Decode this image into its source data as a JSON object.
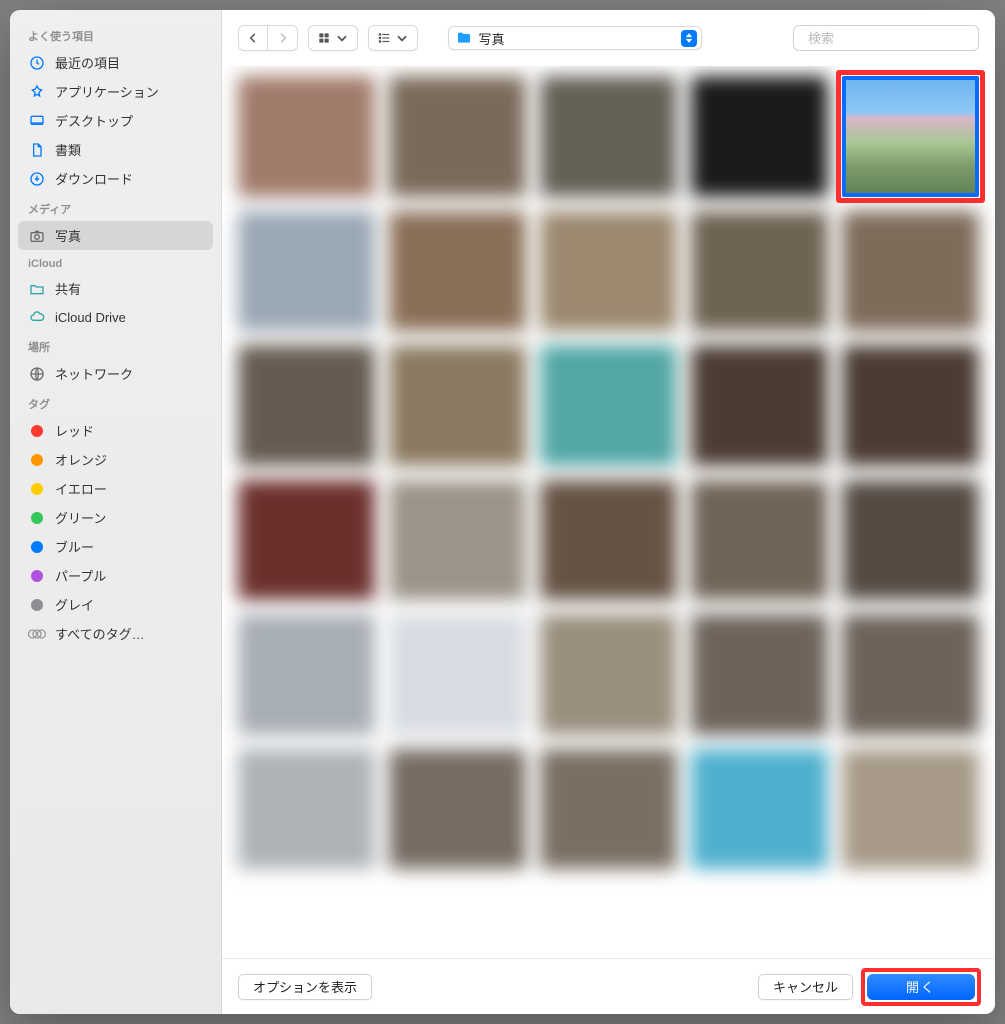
{
  "sidebar": {
    "favorites_label": "よく使う項目",
    "media_label": "メディア",
    "icloud_label": "iCloud",
    "locations_label": "場所",
    "tags_label": "タグ",
    "favorites": [
      {
        "label": "最近の項目"
      },
      {
        "label": "アプリケーション"
      },
      {
        "label": "デスクトップ"
      },
      {
        "label": "書類"
      },
      {
        "label": "ダウンロード"
      }
    ],
    "media": [
      {
        "label": "写真"
      }
    ],
    "icloud": [
      {
        "label": "共有"
      },
      {
        "label": "iCloud Drive"
      }
    ],
    "locations": [
      {
        "label": "ネットワーク"
      }
    ],
    "tags": [
      {
        "label": "レッド",
        "color": "#ff3b30"
      },
      {
        "label": "オレンジ",
        "color": "#ff9500"
      },
      {
        "label": "イエロー",
        "color": "#ffcc00"
      },
      {
        "label": "グリーン",
        "color": "#34c759"
      },
      {
        "label": "ブルー",
        "color": "#007aff"
      },
      {
        "label": "パープル",
        "color": "#af52de"
      },
      {
        "label": "グレイ",
        "color": "#8e8e93"
      }
    ],
    "all_tags_label": "すべてのタグ…"
  },
  "toolbar": {
    "location_label": "写真",
    "search_placeholder": "検索"
  },
  "footer": {
    "options_label": "オプションを表示",
    "cancel_label": "キャンセル",
    "open_label": "開く"
  },
  "grid": {
    "thumb_count": 30,
    "selected_index": 4,
    "blur_colors": [
      "#a07a6a",
      "#7a6a5a",
      "#646056",
      "#1a1a1a",
      "#7a735f",
      "#9aa7b5",
      "#8a6f58",
      "#9b886f",
      "#6e6352",
      "#7e6b5a",
      "#655b50",
      "#8b7a61",
      "#52a7a5",
      "#4b3c33",
      "#4b3c33",
      "#6b2f2c",
      "#9c9488",
      "#655344",
      "#706357",
      "#544a42",
      "#a8aeb5",
      "#d8dce2",
      "#9a8f7e",
      "#6d635a",
      "#6d635a",
      "#aeb3b7",
      "#766c62",
      "#7a6f63",
      "#4fb0cd",
      "#a79a88"
    ]
  }
}
